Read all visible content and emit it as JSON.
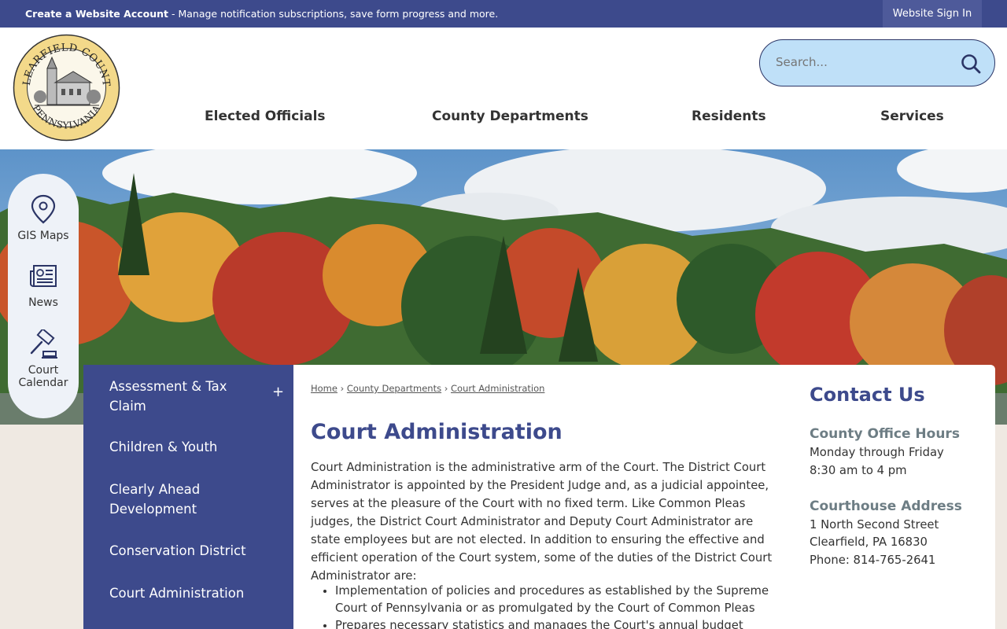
{
  "topbar": {
    "create_account_link": "Create a Website Account",
    "message": " - Manage notification subscriptions, save form progress and more.",
    "sign_in": "Website Sign In"
  },
  "header": {
    "logo_text_top": "CLEARFIELD COUNTY",
    "logo_text_bottom": "PENNSYLVANIA",
    "search_placeholder": "Search...",
    "nav": [
      "Elected Officials",
      "County Departments",
      "Residents",
      "Services"
    ]
  },
  "quick_links": [
    {
      "label": "GIS Maps",
      "icon": "map-pin-icon"
    },
    {
      "label": "News",
      "icon": "newspaper-icon"
    },
    {
      "label_line1": "Court",
      "label_line2": "Calendar",
      "icon": "gavel-icon"
    }
  ],
  "side_menu": {
    "items": [
      {
        "label": "Assessment & Tax Claim",
        "expand": "+"
      },
      {
        "label": "Children & Youth"
      },
      {
        "label": "Clearly Ahead Development"
      },
      {
        "label": "Conservation District"
      },
      {
        "label": "Court Administration"
      }
    ]
  },
  "breadcrumb": {
    "home": "Home",
    "sep": " › ",
    "departments": "County Departments",
    "current": "Court Administration"
  },
  "main": {
    "title": "Court Administration",
    "intro": "Court Administration is the administrative arm of the Court. The District Court Administrator is appointed by the President Judge and, as a judicial appointee, serves at the pleasure of the Court with no fixed term. Like Common Pleas judges, the District Court Administrator and Deputy Court Administrator are state employees but are not elected. In addition to ensuring the effective and efficient operation of the Court system, some of the duties of the District Court Administrator are:",
    "bullets": [
      "Implementation of policies and procedures as established by the Supreme Court of Pennsylvania or as promulgated by the Court of Common Pleas",
      "Prepares necessary statistics and manages the Court's annual budget"
    ]
  },
  "contact": {
    "title": "Contact Us",
    "hours_heading": "County Office Hours",
    "hours_line1": "Monday through Friday",
    "hours_line2": "8:30 am to 4 pm",
    "address_heading": "Courthouse Address",
    "address_line1": "1 North Second Street",
    "address_line2": "Clearfield, PA 16830",
    "phone": "Phone: 814-765-2641"
  },
  "colors": {
    "brand_navy": "#3d4a8c",
    "search_bg": "#bfe0f8",
    "heading_gray": "#6d7d84"
  }
}
